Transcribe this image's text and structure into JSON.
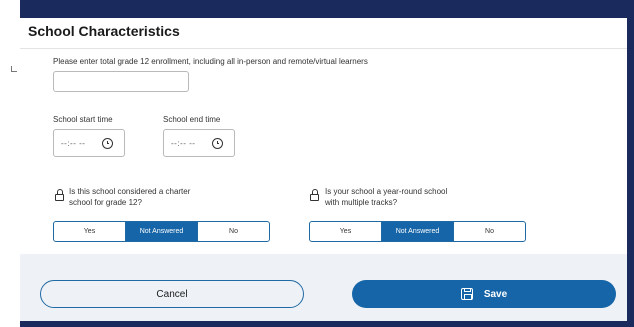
{
  "section": {
    "title": "School Characteristics"
  },
  "enrollment": {
    "prompt": "Please enter total grade 12 enrollment, including all in-person and remote/virtual learners",
    "value": ""
  },
  "start_time": {
    "label": "School start time",
    "placeholder": "--:-- --",
    "icon": "clock-icon"
  },
  "end_time": {
    "label": "School end time",
    "placeholder": "--:-- --",
    "icon": "clock-icon"
  },
  "charter": {
    "question_line1": "Is this school considered a charter",
    "question_line2": "school for grade 12?",
    "icon": "lock-icon",
    "options": [
      "Yes",
      "Not Answered",
      "No"
    ],
    "selected": "Not Answered"
  },
  "year_round": {
    "question_line1": "Is your school a year-round school",
    "question_line2": "with multiple tracks?",
    "icon": "lock-icon",
    "options": [
      "Yes",
      "Not Answered",
      "No"
    ],
    "selected": "Not Answered"
  },
  "footer": {
    "cancel_label": "Cancel",
    "save_label": "Save",
    "save_icon": "floppy-disk-icon"
  },
  "colors": {
    "accent": "#1565a8",
    "frame": "#1b2a5c"
  }
}
